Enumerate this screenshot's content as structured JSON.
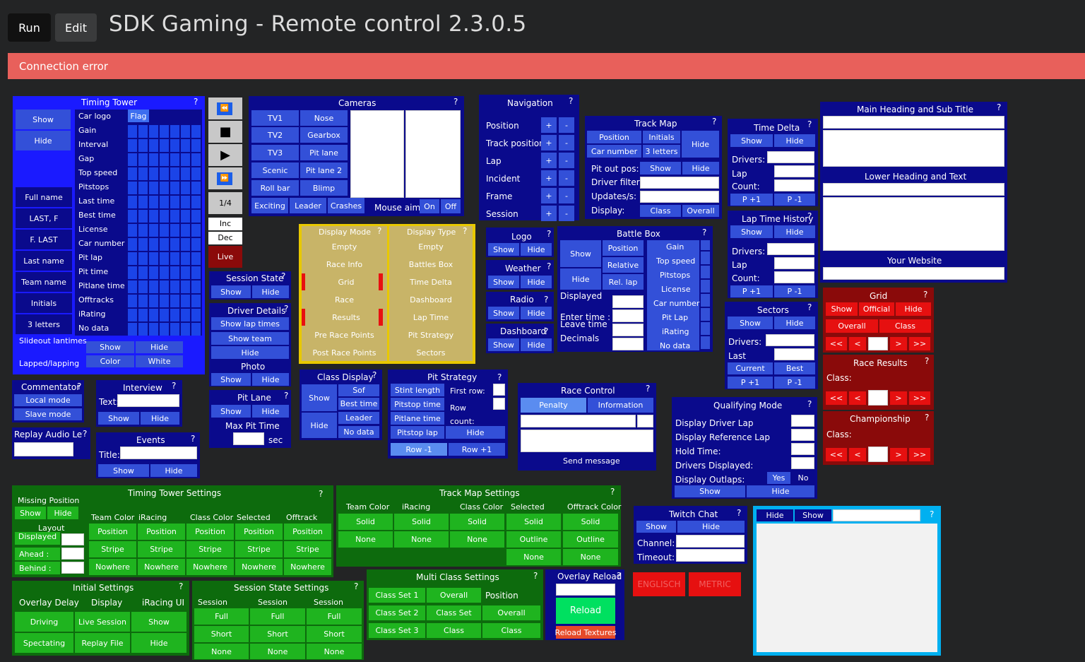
{
  "header": {
    "run": "Run",
    "edit": "Edit",
    "title": "SDK Gaming - Remote control 2.3.0.5"
  },
  "error": "Connection error",
  "timing_tower": {
    "title": "Timing Tower",
    "show": "Show",
    "hide": "Hide",
    "rows": [
      "Car logo",
      "Gain",
      "Interval",
      "Gap",
      "Top speed",
      "Pitstops",
      "Last time",
      "Best time",
      "License",
      "Car number",
      "Pit lap",
      "Pit time",
      "Pitlane time",
      "Offtracks",
      "iRating",
      "No data"
    ],
    "flag": "Flag",
    "names": [
      "Full name",
      "LAST, F",
      "F. LAST",
      "Last name",
      "Team name",
      "Initials",
      "3 letters"
    ],
    "slideout": "Slideout lantimes",
    "lapped": "Lapped/lapping",
    "color": "Color",
    "white": "White",
    "show2": "Show",
    "hide2": "Hide"
  },
  "playback": {
    "q": "?",
    "page": "1/4",
    "inc": "Inc",
    "dec": "Dec",
    "live": "Live"
  },
  "cameras": {
    "title": "Cameras",
    "left": [
      "TV1",
      "TV2",
      "TV3",
      "Scenic",
      "Roll bar"
    ],
    "right": [
      "Nose",
      "Gearbox",
      "Pit lane",
      "Pit lane 2",
      "Blimp"
    ],
    "bottom": [
      "Exciting",
      "Leader",
      "Crashes"
    ],
    "mouse_aim": "Mouse aim:",
    "on": "On",
    "off": "Off"
  },
  "navigation": {
    "title": "Navigation",
    "rows": [
      "Position",
      "Track position",
      "Lap",
      "Incident",
      "Frame",
      "Session"
    ],
    "plus": "+",
    "minus": "-"
  },
  "track_map": {
    "title": "Track Map",
    "position": "Position",
    "initials": "Initials",
    "car_number": "Car number",
    "three_letters": "3 letters",
    "hide": "Hide",
    "pit_out": "Pit out pos:",
    "driver_filter": "Driver filter:",
    "updates": "Updates/s:",
    "display": "Display:",
    "show": "Show",
    "hide2": "Hide",
    "class": "Class",
    "overall": "Overall"
  },
  "time_delta": {
    "title": "Time Delta",
    "show": "Show",
    "hide": "Hide",
    "drivers": "Drivers:",
    "lap": "Lap",
    "count": "Count:",
    "p1": "P +1",
    "m1": "P -1"
  },
  "lap_history": {
    "title": "Lap Time History",
    "show": "Show",
    "hide": "Hide",
    "drivers": "Drivers:",
    "lap": "Lap",
    "count": "Count:",
    "p1": "P +1",
    "m1": "P -1"
  },
  "sectors": {
    "title": "Sectors",
    "show": "Show",
    "hide": "Hide",
    "drivers": "Drivers:",
    "last": "Last",
    "current": "Current",
    "best": "Best",
    "p1": "P +1",
    "m1": "P -1"
  },
  "main_heading": {
    "title": "Main Heading and Sub Title",
    "lower": "Lower Heading and Text",
    "website": "Your Website"
  },
  "grid": {
    "title": "Grid",
    "show": "Show",
    "official": "Official",
    "hide": "Hide",
    "overall": "Overall",
    "class": "Class",
    "nav": [
      "<<",
      "<",
      ">",
      ">>"
    ]
  },
  "race_results": {
    "title": "Race Results",
    "class": "Class:"
  },
  "championship": {
    "title": "Championship",
    "class": "Class:"
  },
  "display_mode": {
    "title": "Display Mode",
    "items": [
      "Empty",
      "Race Info",
      "Grid",
      "Race",
      "Results",
      "Pre Race Points",
      "Post Race Points"
    ]
  },
  "display_type": {
    "title": "Display Type",
    "items": [
      "Empty",
      "Battles Box",
      "Time Delta",
      "Dashboard",
      "Lap Time",
      "Pit Strategy",
      "Sectors"
    ]
  },
  "logo": {
    "title": "Logo",
    "show": "Show",
    "hide": "Hide"
  },
  "weather": {
    "title": "Weather",
    "show": "Show",
    "hide": "Hide"
  },
  "radio": {
    "title": "Radio",
    "show": "Show",
    "hide": "Hide"
  },
  "dashboard": {
    "title": "Dashboard",
    "show": "Show",
    "hide": "Hide"
  },
  "battle_box": {
    "title": "Battle Box",
    "show": "Show",
    "hide": "Hide",
    "position": "Position",
    "relative": "Relative",
    "rel_lap": "Rel. lap",
    "displayed": "Displayed",
    "enter_time": "Enter time :",
    "leave_time": "Leave time",
    "decimals": "Decimals",
    "items": [
      "Gain",
      "Top speed",
      "Pitstops",
      "License",
      "Car number",
      "Pit Lap",
      "iRating",
      "No data"
    ]
  },
  "session_state": {
    "title": "Session State",
    "show": "Show",
    "hide": "Hide"
  },
  "driver_details": {
    "title": "Driver Details",
    "lap_times": "Show lap times",
    "team": "Show team",
    "hide": "Hide",
    "photo": "Photo",
    "show": "Show",
    "hide2": "Hide"
  },
  "pit_lane": {
    "title": "Pit Lane",
    "show": "Show",
    "hide": "Hide",
    "max": "Max Pit Time",
    "sec": "sec"
  },
  "class_display": {
    "title": "Class Display",
    "show": "Show",
    "hide": "Hide",
    "items": [
      "Sof",
      "Best time",
      "Leader",
      "No data"
    ]
  },
  "pit_strategy": {
    "title": "Pit Strategy",
    "left": [
      "Stint length",
      "Pitstop time",
      "Pitlane time",
      "Pitstop lap"
    ],
    "first_row": "First row:",
    "row_count": "Row count:",
    "hide": "Hide",
    "rowm": "Row -1",
    "rowp": "Row +1"
  },
  "race_control": {
    "title": "Race Control",
    "penalty": "Penalty",
    "information": "Information",
    "send": "Send message"
  },
  "qualifying": {
    "title": "Qualifying Mode",
    "rows": [
      "Display Driver Lap",
      "Display Reference Lap",
      "Hold Time:",
      "Drivers Displayed:",
      "Display Outlaps:"
    ],
    "yes": "Yes",
    "no": "No",
    "show": "Show",
    "hide": "Hide"
  },
  "commentator": {
    "title": "Commentator",
    "local": "Local mode",
    "slave": "Slave mode"
  },
  "interview": {
    "title": "Interview",
    "text": "Text:",
    "show": "Show",
    "hide": "Hide"
  },
  "replay_audio": {
    "title": "Replay Audio Level"
  },
  "events": {
    "title": "Events",
    "title_lbl": "Title:",
    "show": "Show",
    "hide": "Hide"
  },
  "tt_settings": {
    "title": "Timing Tower Settings",
    "missing": "Missing Position",
    "show": "Show",
    "hide": "Hide",
    "layout": "Layout",
    "displayed": "Displayed",
    "ahead": "Ahead :",
    "behind": "Behind :",
    "cols": [
      "Team Color",
      "iRacing",
      "Class Color",
      "Selected",
      "Offtrack"
    ],
    "rows": [
      "Position",
      "Stripe",
      "Nowhere"
    ]
  },
  "tm_settings": {
    "title": "Track Map Settings",
    "cols": [
      "Team Color",
      "iRacing",
      "Class Color",
      "Selected",
      "Offtrack Color"
    ],
    "r1": [
      "Solid",
      "Solid",
      "Solid",
      "Solid",
      "Solid"
    ],
    "r2": [
      "None",
      "None",
      "None",
      "Outline",
      "Outline"
    ],
    "r3": [
      "None",
      "None"
    ]
  },
  "initial": {
    "title": "Initial Settings",
    "cols": [
      "Overlay Delay",
      "Display",
      "iRacing UI"
    ],
    "r1": [
      "Driving",
      "Live Session",
      "Show"
    ],
    "r2": [
      "Spectating",
      "Replay File",
      "Hide"
    ]
  },
  "session_settings": {
    "title": "Session State Settings",
    "col": "Session",
    "r": [
      "Full",
      "Short",
      "None"
    ]
  },
  "multi_class": {
    "title": "Multi Class Settings",
    "sets": [
      "Class Set 1",
      "Class Set 2",
      "Class Set 3"
    ],
    "c2": [
      "Overall",
      "Class Set",
      "Class"
    ],
    "position": "Position",
    "overall": "Overall",
    "class": "Class"
  },
  "overlay_reload": {
    "title": "Overlay Reload",
    "reload": "Reload",
    "textures": "Reload Textures"
  },
  "twitch": {
    "title": "Twitch Chat",
    "show": "Show",
    "hide": "Hide",
    "channel": "Channel:",
    "timeout": "Timeout:"
  },
  "lang": {
    "english": "ENGLISCH",
    "metric": "METRIC"
  },
  "browser": {
    "hide": "Hide",
    "show": "Show",
    "q": "?"
  },
  "q": "?"
}
